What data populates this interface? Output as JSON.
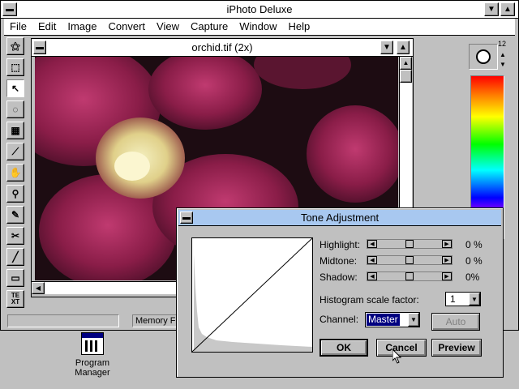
{
  "app": {
    "title": "iPhoto Deluxe",
    "menu": [
      "File",
      "Edit",
      "Image",
      "Convert",
      "View",
      "Capture",
      "Window",
      "Help"
    ]
  },
  "image_window": {
    "title": "orchid.tif (2x)"
  },
  "status": {
    "text": "Memory Fr"
  },
  "palette": {
    "value": "12"
  },
  "tools": [
    {
      "name": "magic-wand-icon"
    },
    {
      "name": "lasso-select-icon"
    },
    {
      "name": "pointer-icon"
    },
    {
      "name": "auto-select-icon"
    },
    {
      "name": "mask-icon"
    },
    {
      "name": "eyedropper-icon"
    },
    {
      "name": "hand-icon"
    },
    {
      "name": "zoom-icon"
    },
    {
      "name": "brush-icon"
    },
    {
      "name": "clone-icon"
    },
    {
      "name": "line-icon"
    },
    {
      "name": "eraser-icon"
    },
    {
      "name": "text-icon",
      "label": "TE\nXT"
    }
  ],
  "dialog": {
    "title": "Tone Adjustment",
    "highlight": {
      "label": "Highlight:",
      "value": "0 %"
    },
    "midtone": {
      "label": "Midtone:",
      "value": "0 %"
    },
    "shadow": {
      "label": "Shadow:",
      "value": "0%"
    },
    "histogram_scale": {
      "label": "Histogram scale factor:",
      "value": "1"
    },
    "channel": {
      "label": "Channel:",
      "value": "Master"
    },
    "buttons": {
      "auto": "Auto",
      "ok": "OK",
      "cancel": "Cancel",
      "preview": "Preview"
    }
  },
  "desktop": {
    "program_manager": "Program Manager"
  },
  "colors": {
    "title_active": "#a8c8f0",
    "face": "#c0c0c0",
    "selection": "#000080"
  }
}
